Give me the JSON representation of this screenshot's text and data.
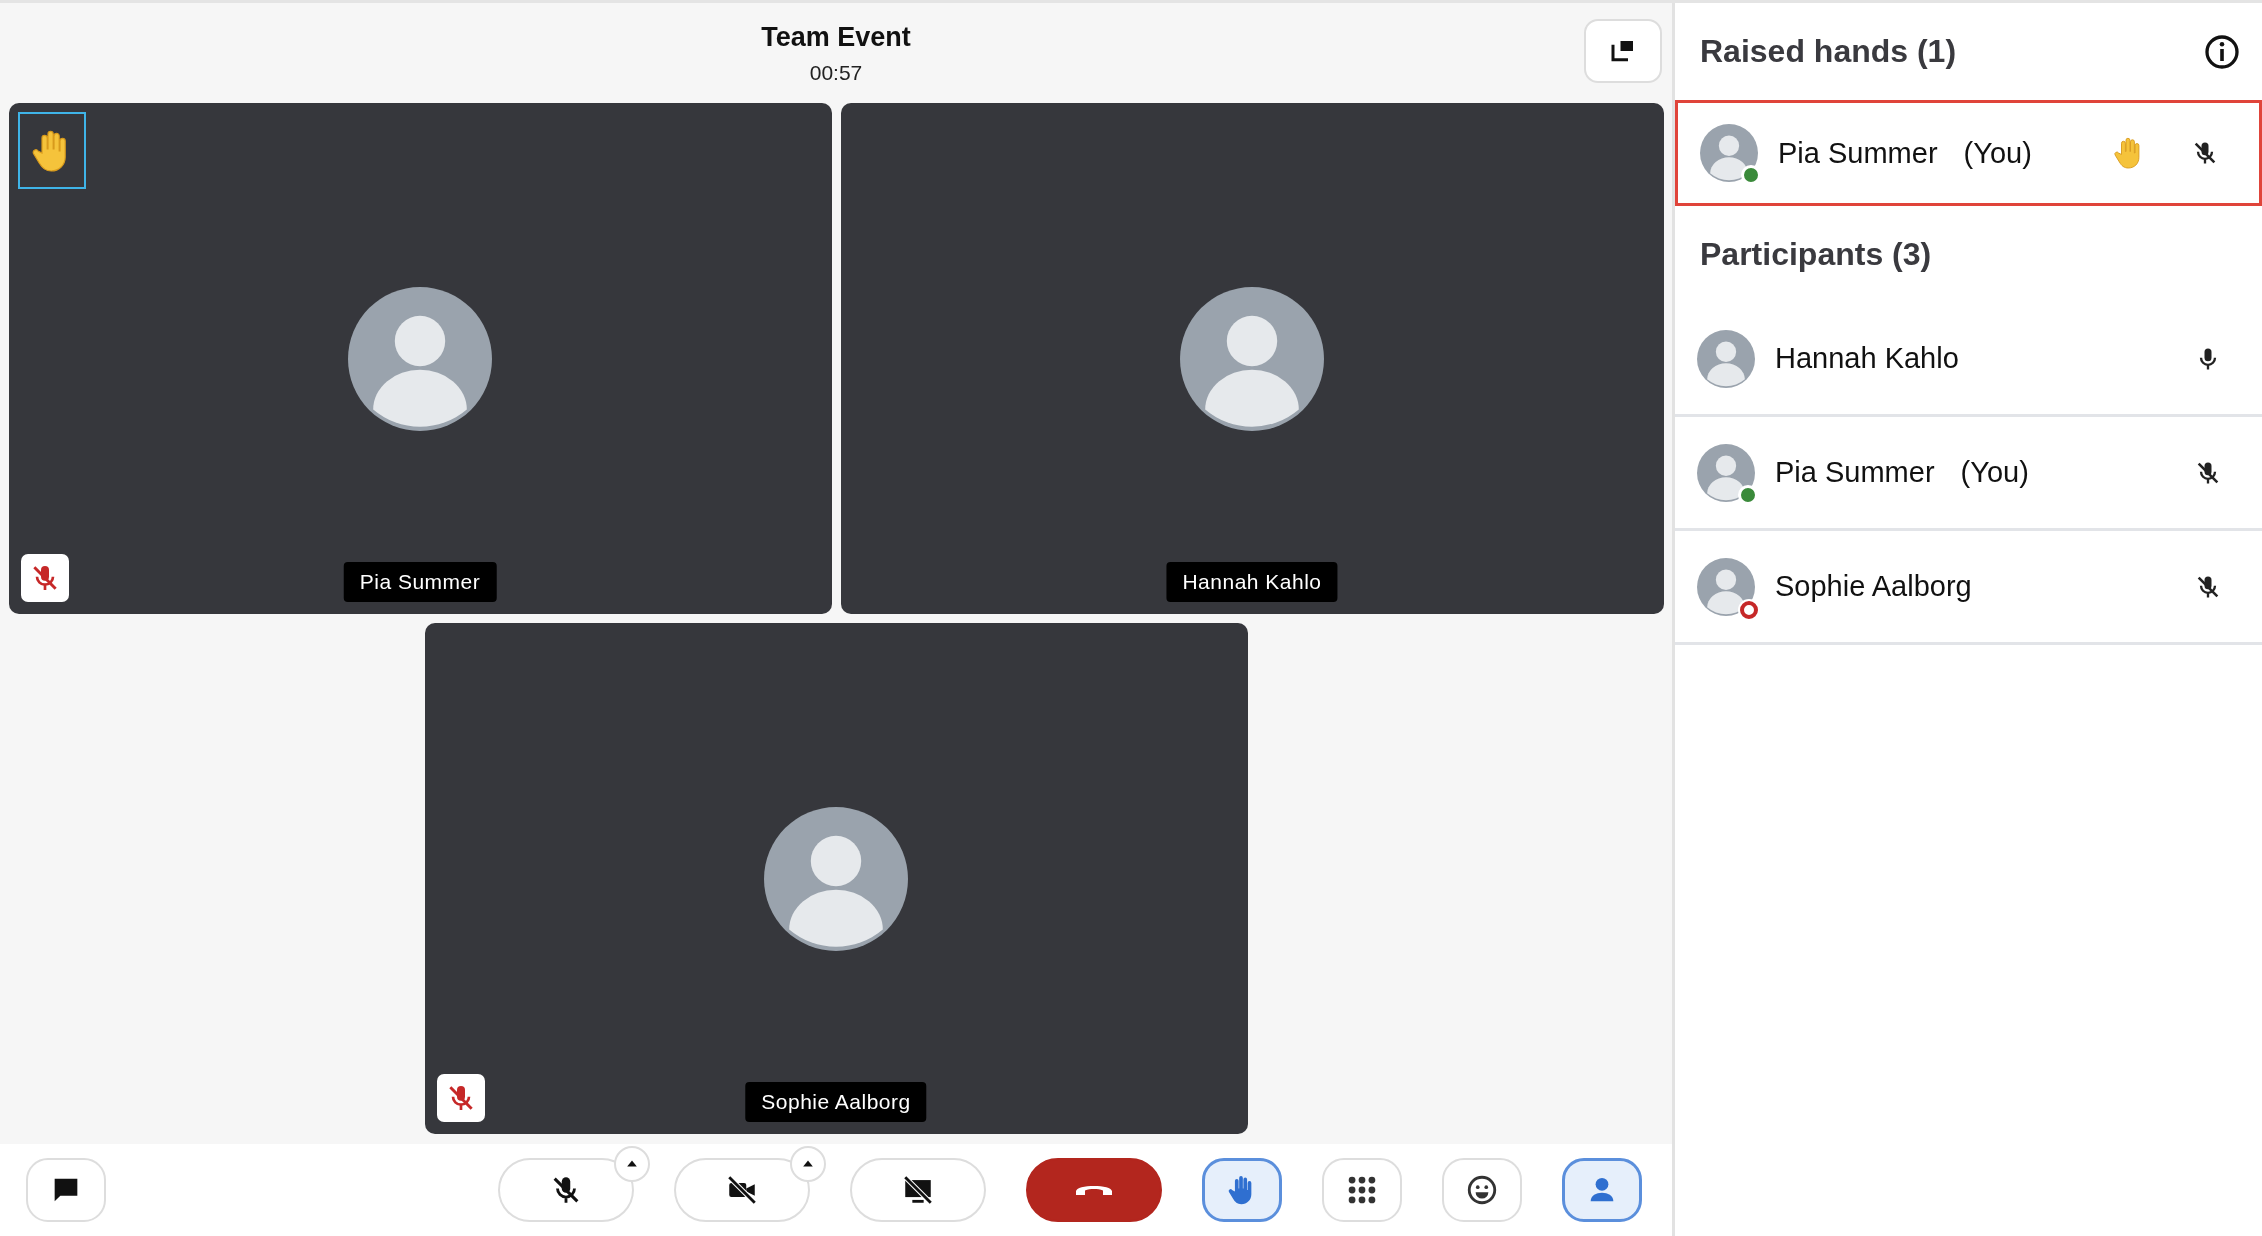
{
  "header": {
    "title": "Team Event",
    "timer": "00:57"
  },
  "tiles": [
    {
      "name": "Pia Summer",
      "hand_raised": true,
      "muted": true
    },
    {
      "name": "Hannah Kahlo",
      "hand_raised": false,
      "muted": false
    },
    {
      "name": "Sophie Aalborg",
      "hand_raised": false,
      "muted": true
    }
  ],
  "toolbar": [
    {
      "kind": "chat",
      "selected": false,
      "has_options": false
    },
    {
      "kind": "mic",
      "selected": false,
      "off": true,
      "has_options": true
    },
    {
      "kind": "camera",
      "selected": false,
      "off": true,
      "has_options": true
    },
    {
      "kind": "screen",
      "selected": false,
      "off": true,
      "has_options": false
    },
    {
      "kind": "hangup",
      "selected": false,
      "has_options": false
    },
    {
      "kind": "hand",
      "selected": true,
      "has_options": false
    },
    {
      "kind": "dialpad",
      "selected": false,
      "has_options": false
    },
    {
      "kind": "emoji",
      "selected": false,
      "has_options": false
    },
    {
      "kind": "participants",
      "selected": true,
      "has_options": false
    }
  ],
  "raised_hands": {
    "title": "Raised hands (1)",
    "people": [
      {
        "name": "Pia Summer",
        "suffix": "(You)",
        "status": {
          "kind": "filled",
          "color": "#3a8a3a"
        },
        "hand_raised": true,
        "muted": true,
        "selected": true
      }
    ]
  },
  "participants": {
    "title": "Participants (3)",
    "people": [
      {
        "name": "Hannah Kahlo",
        "hand_raised": false,
        "muted": false,
        "selected": false
      },
      {
        "name": "Pia Summer",
        "suffix": "(You)",
        "status": {
          "kind": "filled",
          "color": "#3a8a3a"
        },
        "hand_raised": false,
        "muted": true,
        "selected": false
      },
      {
        "name": "Sophie Aalborg",
        "status": {
          "kind": "ring",
          "color": "#c62828"
        },
        "hand_raised": false,
        "muted": true,
        "selected": false
      }
    ]
  }
}
